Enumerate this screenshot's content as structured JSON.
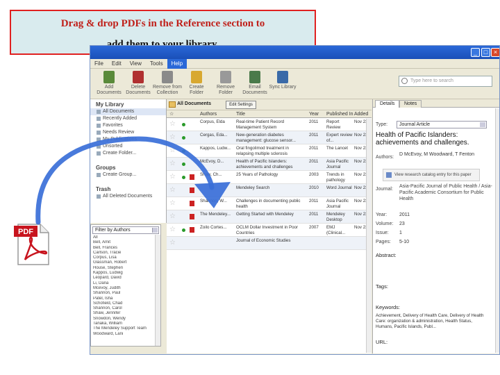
{
  "callout": {
    "line1_a": "Drag & drop ",
    "line1_b": "PDFs in the Reference section to",
    "line2": "add them to your library."
  },
  "window": {
    "menu": [
      "File",
      "Edit",
      "View",
      "Tools",
      "Help"
    ],
    "active_menu": "Help",
    "toolbar": [
      {
        "label": "Add Documents",
        "icon": "add-documents-icon",
        "color": "#5a8a3a"
      },
      {
        "label": "Delete Documents",
        "icon": "delete-documents-icon",
        "color": "#b03030"
      },
      {
        "label": "Remove from Collection",
        "icon": "remove-collection-icon",
        "color": "#8a8a8a"
      },
      {
        "label": "Create Folder",
        "icon": "create-folder-icon",
        "color": "#d8a830"
      },
      {
        "label": "Remove Folder",
        "icon": "remove-folder-icon",
        "color": "#999999"
      },
      {
        "label": "Email Documents",
        "icon": "email-icon",
        "color": "#4a7a4a"
      },
      {
        "label": "Sync Library",
        "icon": "sync-icon",
        "color": "#3a6aa8"
      }
    ],
    "search_placeholder": "Type here to search"
  },
  "sidebar": {
    "my_library": "My Library",
    "items": [
      "All Documents",
      "Recently Added",
      "Favorites",
      "Needs Review",
      "My Publications",
      "Unsorted",
      "Create Folder..."
    ],
    "groups": "Groups",
    "groups_items": [
      "Create Group..."
    ],
    "trash": "Trash",
    "trash_items": [
      "All Deleted Documents"
    ]
  },
  "filter": {
    "select": "Filter by Authors",
    "items": [
      "All",
      "Bell, Amit",
      "Bell, Frances",
      "Carlson, Tracie",
      "Corpus, Lisa",
      "Glassman, Robert",
      "House, Stephen",
      "Kappos, Ludwig",
      "Leopard, David",
      "Li, Dana",
      "Mcevoy, Judith",
      "Shannon, Paul",
      "Patel, Isha",
      "Schofield, Chad",
      "Shannon, Carol",
      "Shaw, Jennifer",
      "Snowdon, Wendy",
      "Tanaka, William",
      "The Mendeley Support Team",
      "Woodward, Lani"
    ]
  },
  "main": {
    "title": "All Documents",
    "edit_settings": "Edit Settings",
    "columns": [
      "Authors",
      "Title",
      "Year",
      "Published In",
      "Added"
    ],
    "rows": [
      {
        "authors": "Corpus, Elda",
        "title": "Real-time Patient Record Management System",
        "year": "2011",
        "pub": "Report Review",
        "added": "Nov 23",
        "pdf": false,
        "dot": true
      },
      {
        "authors": "Cergas, Eda...",
        "title": "New-generation diabetes management: glucose sensor...",
        "year": "2011",
        "pub": "Expert review of...",
        "added": "Nov 23",
        "pdf": false,
        "dot": true
      },
      {
        "authors": "Kappos, Ludw...",
        "title": "Oral fingolimod treatment in relapsing multiple sclerosis",
        "year": "2011",
        "pub": "The Lancet",
        "added": "Nov 23",
        "pdf": false,
        "dot": true
      },
      {
        "authors": "McEvoy, D...",
        "title": "Health of Pacific Islanders: achievements and challenges",
        "year": "2011",
        "pub": "Asia Pacific Journal",
        "added": "Nov 23",
        "pdf": false,
        "dot": true
      },
      {
        "authors": "Shaw, Ch...",
        "title": "25 Years of Pathology",
        "year": "2003",
        "pub": "Trends in pathology",
        "added": "Nov 23",
        "pdf": true,
        "dot": true
      },
      {
        "authors": "",
        "title": "Mendeley Search",
        "year": "2010",
        "pub": "Word Journal",
        "added": "Nov 23",
        "pdf": true,
        "dot": false
      },
      {
        "authors": "Shannon, W...",
        "title": "Challenges in documenting public health",
        "year": "2011",
        "pub": "Asia Pacific Journal",
        "added": "Nov 23",
        "pdf": true,
        "dot": false
      },
      {
        "authors": "The Mendeley...",
        "title": "Getting Started with Mendeley",
        "year": "2011",
        "pub": "Mendeley Desktop",
        "added": "Nov 23",
        "pdf": true,
        "dot": false
      },
      {
        "authors": "Zoilo Cortes...",
        "title": "OCLM Dollar Investment in Poor Countries",
        "year": "2007",
        "pub": "EMJ (Clinical...",
        "added": "Nov 23",
        "pdf": true,
        "dot": true
      },
      {
        "authors": "",
        "title": "Journal of Economic Studies",
        "year": "",
        "pub": "",
        "added": "",
        "pdf": false,
        "dot": false
      }
    ]
  },
  "right": {
    "tabs": [
      "Details",
      "Notes"
    ],
    "type_label": "Type:",
    "type_value": "Journal Article",
    "heading": "Health of Pacific Islanders: achievements and challenges.",
    "authors_label": "Authors:",
    "authors_value": "D McEvoy, M Woodward, T Fenton",
    "catalog": "View research catalog entry for this paper",
    "journal_label": "Journal:",
    "journal_value": "Asia-Pacific Journal of Public Health / Asia-Pacific Academic Consortium for Public Health",
    "year_label": "Year:",
    "year_value": "2011",
    "volume_label": "Volume:",
    "volume_value": "23",
    "issue_label": "Issue:",
    "issue_value": "1",
    "pages_label": "Pages:",
    "pages_value": "5-10",
    "abstract": "Abstract:",
    "tags": "Tags:",
    "keywords": "Keywords:",
    "keywords_value": "Achievement, Delivery of Health Care, Delivery of Health Care: organization & administration, Health Status, Humans, Pacific Islands, Publ...",
    "url": "URL:"
  },
  "pdf_icon_label": "PDF"
}
